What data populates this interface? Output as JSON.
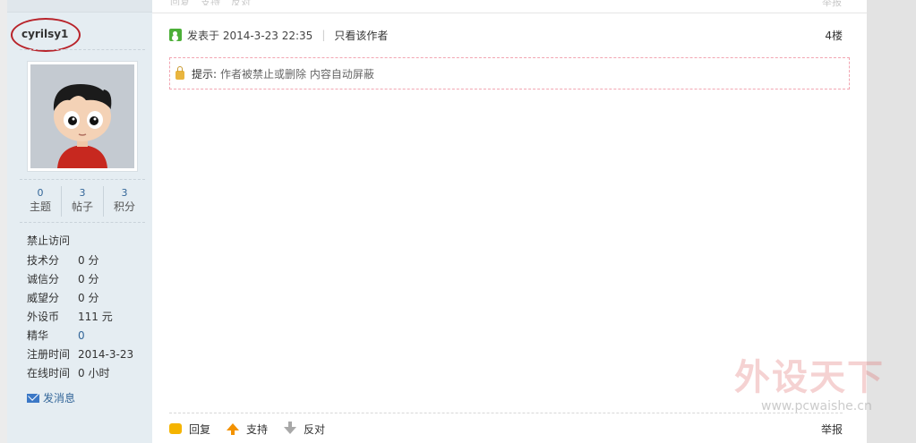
{
  "top_fragment": {
    "items": [
      "回复",
      "支持",
      "反对"
    ],
    "report": "举报"
  },
  "user": {
    "username": "cyrilsy1",
    "stats": [
      {
        "value": "0",
        "label": "主题"
      },
      {
        "value": "3",
        "label": "帖子"
      },
      {
        "value": "3",
        "label": "积分"
      }
    ],
    "status": "禁止访问",
    "info": [
      {
        "key": "技术分",
        "value": "0 分"
      },
      {
        "key": "诚信分",
        "value": "0 分"
      },
      {
        "key": "威望分",
        "value": "0 分"
      },
      {
        "key": "外设币",
        "value": "111 元"
      },
      {
        "key": "精华",
        "value": "0"
      },
      {
        "key": "注册时间",
        "value": "2014-3-23"
      },
      {
        "key": "在线时间",
        "value": "0 小时"
      }
    ],
    "send_message": "发消息"
  },
  "post": {
    "posted_at": "发表于 2014-3-23 22:35",
    "only_author": "只看该作者",
    "floor": "4楼",
    "notice_label": "提示:",
    "notice_text": "作者被禁止或删除 内容自动屏蔽",
    "actions": {
      "reply": "回复",
      "support": "支持",
      "oppose": "反对",
      "report": "举报"
    }
  },
  "watermark": {
    "text": "外设天下",
    "url": "www.pcwaishe.cn"
  },
  "colors": {
    "profile_bg": "#e5edf2",
    "link": "#336699",
    "highlight_circle": "#b8232a",
    "notice_border": "#f2a6b2"
  }
}
